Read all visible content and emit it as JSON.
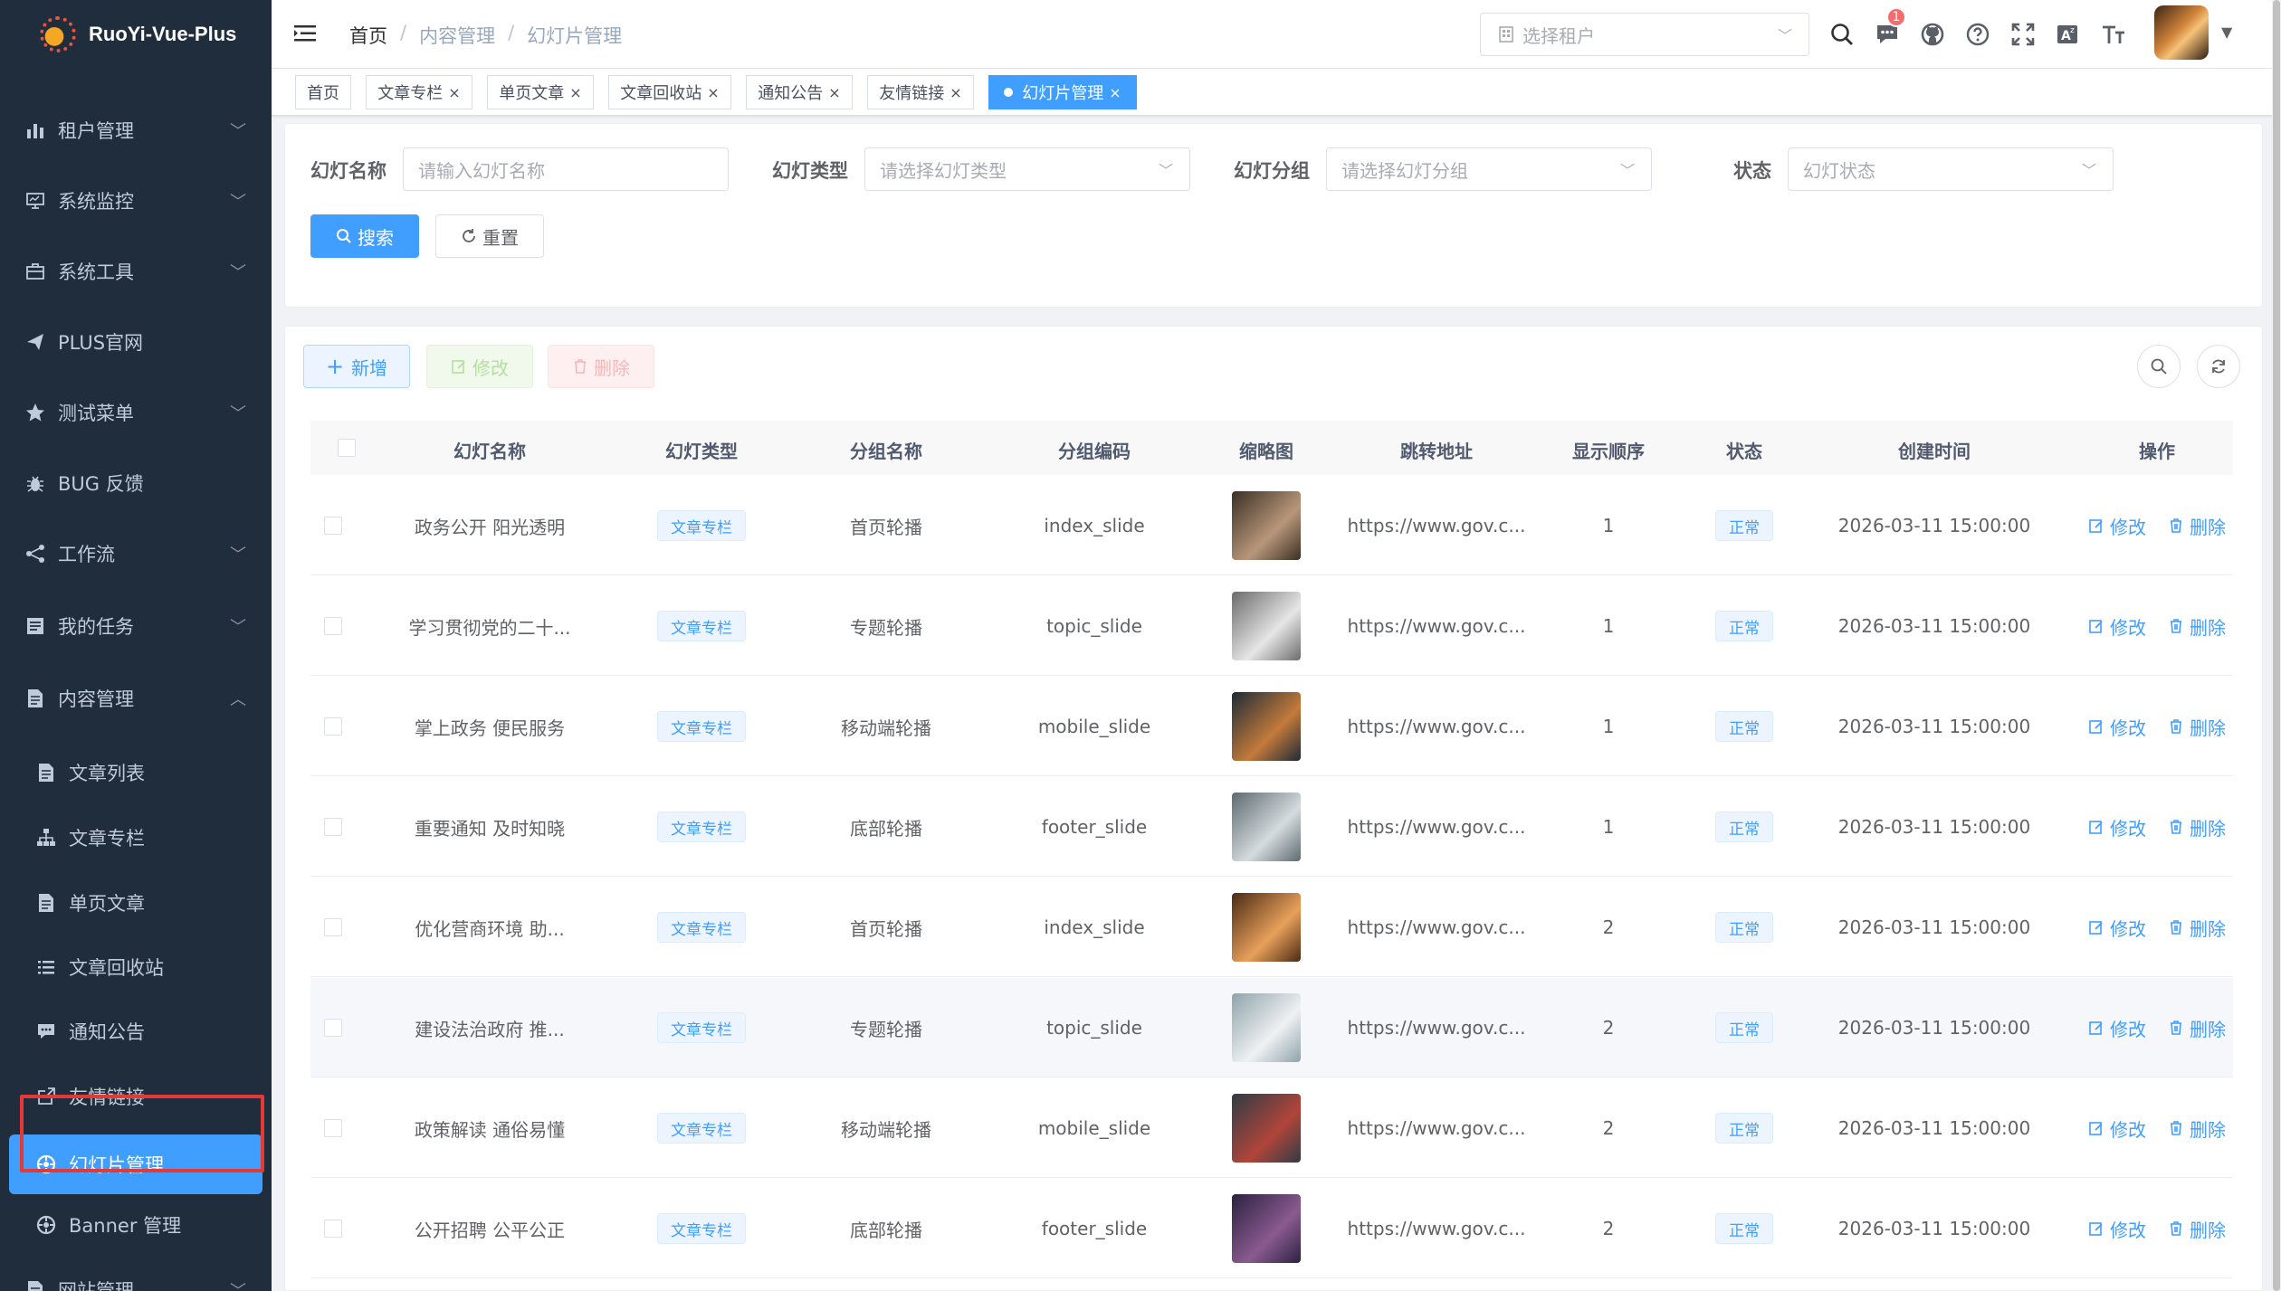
{
  "app": {
    "title": "RuoYi-Vue-Plus"
  },
  "sidebar": {
    "items": [
      {
        "label": "租户管理",
        "icon": "chart-bar-icon",
        "expandable": true
      },
      {
        "label": "系统监控",
        "icon": "monitor-icon",
        "expandable": true
      },
      {
        "label": "系统工具",
        "icon": "toolbox-icon",
        "expandable": true
      },
      {
        "label": "PLUS官网",
        "icon": "paper-plane-icon",
        "expandable": false
      },
      {
        "label": "测试菜单",
        "icon": "star-icon",
        "expandable": true
      },
      {
        "label": "BUG 反馈",
        "icon": "bug-icon",
        "expandable": false
      },
      {
        "label": "工作流",
        "icon": "workflow-icon",
        "expandable": true
      },
      {
        "label": "我的任务",
        "icon": "task-icon",
        "expandable": true
      },
      {
        "label": "内容管理",
        "icon": "document-icon",
        "expandable": true,
        "expanded": true
      },
      {
        "label": "文章列表",
        "icon": "document-icon",
        "sub": true
      },
      {
        "label": "文章专栏",
        "icon": "tree-icon",
        "sub": true
      },
      {
        "label": "单页文章",
        "icon": "document-icon",
        "sub": true
      },
      {
        "label": "文章回收站",
        "icon": "list-icon",
        "sub": true
      },
      {
        "label": "通知公告",
        "icon": "message-icon",
        "sub": true
      },
      {
        "label": "友情链接",
        "icon": "external-link-icon",
        "sub": true
      },
      {
        "label": "幻灯片管理",
        "icon": "slides-icon",
        "sub": true,
        "active": true
      },
      {
        "label": "Banner 管理",
        "icon": "slides-icon",
        "sub": true
      },
      {
        "label": "网站管理",
        "icon": "document-icon",
        "expandable": true
      }
    ]
  },
  "navbar": {
    "breadcrumb": [
      "首页",
      "内容管理",
      "幻灯片管理"
    ],
    "tenant_placeholder": "选择租户",
    "message_count": "1",
    "icons": [
      "search-icon",
      "message-icon",
      "github-icon",
      "help-icon",
      "fullscreen-icon",
      "language-icon",
      "font-size-icon"
    ]
  },
  "tags": [
    {
      "label": "首页",
      "closable": false
    },
    {
      "label": "文章专栏",
      "closable": true
    },
    {
      "label": "单页文章",
      "closable": true
    },
    {
      "label": "文章回收站",
      "closable": true
    },
    {
      "label": "通知公告",
      "closable": true
    },
    {
      "label": "友情链接",
      "closable": true
    },
    {
      "label": "幻灯片管理",
      "closable": true,
      "active": true
    }
  ],
  "search": {
    "name_label": "幻灯名称",
    "name_placeholder": "请输入幻灯名称",
    "type_label": "幻灯类型",
    "type_placeholder": "请选择幻灯类型",
    "group_label": "幻灯分组",
    "group_placeholder": "请选择幻灯分组",
    "status_label": "状态",
    "status_placeholder": "幻灯状态",
    "search_button": "搜索",
    "reset_button": "重置"
  },
  "toolbar": {
    "add": "新增",
    "edit": "修改",
    "delete": "删除"
  },
  "table": {
    "columns": [
      "幻灯名称",
      "幻灯类型",
      "分组名称",
      "分组编码",
      "缩略图",
      "跳转地址",
      "显示顺序",
      "状态",
      "创建时间",
      "操作"
    ],
    "edit_label": "修改",
    "delete_label": "删除",
    "rows": [
      {
        "name": "政务公开 阳光透明",
        "type": "文章专栏",
        "group": "首页轮播",
        "code": "index_slide",
        "url": "https://www.gov.c...",
        "order": "1",
        "status": "正常",
        "created": "2026-03-11 15:00:00",
        "thumb": [
          "#3a2f24",
          "#b8977a"
        ]
      },
      {
        "name": "学习贯彻党的二十...",
        "type": "文章专栏",
        "group": "专题轮播",
        "code": "topic_slide",
        "url": "https://www.gov.c...",
        "order": "1",
        "status": "正常",
        "created": "2026-03-11 15:00:00",
        "thumb": [
          "#6b6b6b",
          "#e6e6e6"
        ]
      },
      {
        "name": "掌上政务 便民服务",
        "type": "文章专栏",
        "group": "移动端轮播",
        "code": "mobile_slide",
        "url": "https://www.gov.c...",
        "order": "1",
        "status": "正常",
        "created": "2026-03-11 15:00:00",
        "thumb": [
          "#1d2b38",
          "#c47a3a"
        ]
      },
      {
        "name": "重要通知 及时知晓",
        "type": "文章专栏",
        "group": "底部轮播",
        "code": "footer_slide",
        "url": "https://www.gov.c...",
        "order": "1",
        "status": "正常",
        "created": "2026-03-11 15:00:00",
        "thumb": [
          "#5d6a70",
          "#d5dbde"
        ]
      },
      {
        "name": "优化营商环境 助...",
        "type": "文章专栏",
        "group": "首页轮播",
        "code": "index_slide",
        "url": "https://www.gov.c...",
        "order": "2",
        "status": "正常",
        "created": "2026-03-11 15:00:00",
        "thumb": [
          "#4a2a14",
          "#e8a05a"
        ]
      },
      {
        "name": "建设法治政府 推...",
        "type": "文章专栏",
        "group": "专题轮播",
        "code": "topic_slide",
        "url": "https://www.gov.c...",
        "order": "2",
        "status": "正常",
        "created": "2026-03-11 15:00:00",
        "thumb": [
          "#8fa3ab",
          "#eef1f2"
        ]
      },
      {
        "name": "政策解读 通俗易懂",
        "type": "文章专栏",
        "group": "移动端轮播",
        "code": "mobile_slide",
        "url": "https://www.gov.c...",
        "order": "2",
        "status": "正常",
        "created": "2026-03-11 15:00:00",
        "thumb": [
          "#2f3c45",
          "#b0453a"
        ]
      },
      {
        "name": "公开招聘 公平公正",
        "type": "文章专栏",
        "group": "底部轮播",
        "code": "footer_slide",
        "url": "https://www.gov.c...",
        "order": "2",
        "status": "正常",
        "created": "2026-03-11 15:00:00",
        "thumb": [
          "#2b2240",
          "#8a5a8f"
        ]
      }
    ]
  },
  "colors": {
    "primary": "#409eff",
    "sidebar_bg": "#1f2d3d",
    "sidebar_text": "#bfcbd9",
    "highlight_box": "#e53935"
  }
}
